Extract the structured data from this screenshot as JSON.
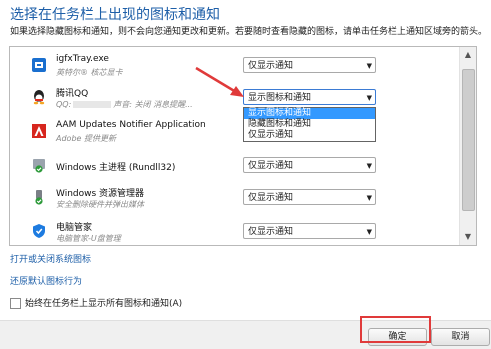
{
  "dialog": {
    "title": "选择在任务栏上出现的图标和通知",
    "description": "如果选择隐藏图标和通知，则不会向您通知更改和更新。若要随时查看隐藏的图标，请单击任务栏上通知区域旁的箭头。"
  },
  "list": {
    "items": [
      {
        "name": "igfxTray.exe",
        "sub": "英特尔® 核芯显卡",
        "behavior": "仅显示通知",
        "icon": "intel-icon"
      },
      {
        "name": "腾讯QQ",
        "sub_prefix": "QQ:",
        "sub_suffix": "声音: 关闭 消息提醒...",
        "behavior": "显示图标和通知",
        "icon": "qq-icon"
      },
      {
        "name": "AAM Updates Notifier Application",
        "sub": "Adobe 提供更新",
        "behavior": "",
        "icon": "adobe-icon"
      },
      {
        "name": "Windows 主进程 (Rundll32)",
        "sub": "",
        "behavior": "仅显示通知",
        "icon": "rundll-shield-icon"
      },
      {
        "name": "Windows 资源管理器",
        "sub": "安全删除硬件并弹出媒体",
        "behavior": "仅显示通知",
        "icon": "usb-icon"
      },
      {
        "name": "电脑管家",
        "sub": "电脑管家-U盘管理",
        "behavior": "仅显示通知",
        "icon": "pc-manager-icon"
      }
    ]
  },
  "dropdown": {
    "options": [
      "显示图标和通知",
      "隐藏图标和通知",
      "仅显示通知"
    ],
    "selected_index": 0
  },
  "links": {
    "toggle_system_icons": "打开或关闭系统图标",
    "restore_defaults": "还原默认图标行为"
  },
  "checkbox": {
    "label": "始终在任务栏上显示所有图标和通知(A)",
    "checked": false
  },
  "buttons": {
    "ok": "确定",
    "cancel": "取消"
  },
  "colors": {
    "title": "#1e5fa8",
    "highlight": "#3399ff",
    "annotation_red": "#e03a3a"
  }
}
